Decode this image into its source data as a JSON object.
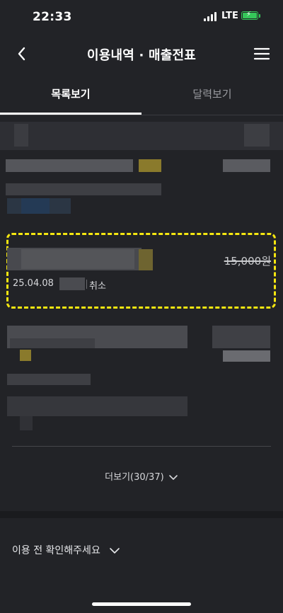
{
  "status_bar": {
    "time": "22:33",
    "network": "LTE"
  },
  "header": {
    "title": "이용내역 · 매출전표",
    "back_icon": "chevron-left-icon",
    "menu_icon": "hamburger-menu-icon"
  },
  "tabs": [
    {
      "label": "목록보기",
      "active": true
    },
    {
      "label": "달력보기",
      "active": false
    }
  ],
  "highlighted_item": {
    "date": "25.04.08",
    "status": "취소",
    "amount": "15,000원",
    "highlight_color": "#f5e610"
  },
  "more_button": {
    "label": "더보기(30/37)"
  },
  "notice": {
    "label": "이용 전 확인해주세요"
  },
  "colors": {
    "background": "#222327",
    "accent_highlight": "#f5e610",
    "battery": "#35c759"
  }
}
